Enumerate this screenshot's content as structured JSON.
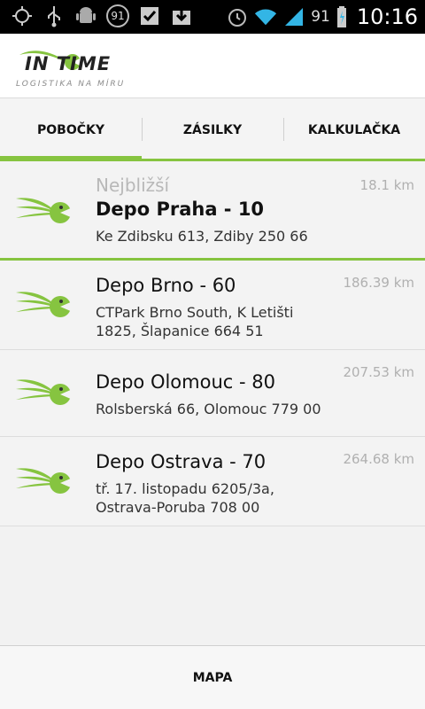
{
  "status_bar": {
    "notification_count": "91",
    "battery_level": "91",
    "time": "10:16",
    "icons": [
      "gps-icon",
      "usb-icon",
      "android-debug-icon",
      "notification-count-icon",
      "checkbox-icon",
      "download-icon",
      "alarm-icon",
      "wifi-icon",
      "signal-icon",
      "battery-icon"
    ]
  },
  "header": {
    "logo_text": "IN TIME",
    "logo_tagline": "LOGISTIKA NA MÍRU"
  },
  "tabs": [
    {
      "label": "POBOČKY",
      "active": true
    },
    {
      "label": "ZÁSILKY",
      "active": false
    },
    {
      "label": "KALKULAČKA",
      "active": false
    }
  ],
  "branches": {
    "section_label": "Nejbližší",
    "items": [
      {
        "name": "Depo Praha - 10",
        "address": "Ke Zdibsku 613, Zdiby 250 66",
        "distance": "18.1 km"
      },
      {
        "name": "Depo Brno - 60",
        "address": "CTPark Brno South, K Letišti 1825, Šlapanice 664 51",
        "distance": "186.39 km"
      },
      {
        "name": "Depo Olomouc - 80",
        "address": "Rolsberská 66, Olomouc 779 00",
        "distance": "207.53 km"
      },
      {
        "name": "Depo Ostrava - 70",
        "address": "tř. 17. listopadu 6205/3a, Ostrava-Poruba 708 00",
        "distance": "264.68 km"
      }
    ]
  },
  "bottom_bar": {
    "map_label": "MAPA"
  },
  "colors": {
    "accent": "#86c440",
    "status_bar": "#000000",
    "distance_text": "#b0b0b0"
  }
}
